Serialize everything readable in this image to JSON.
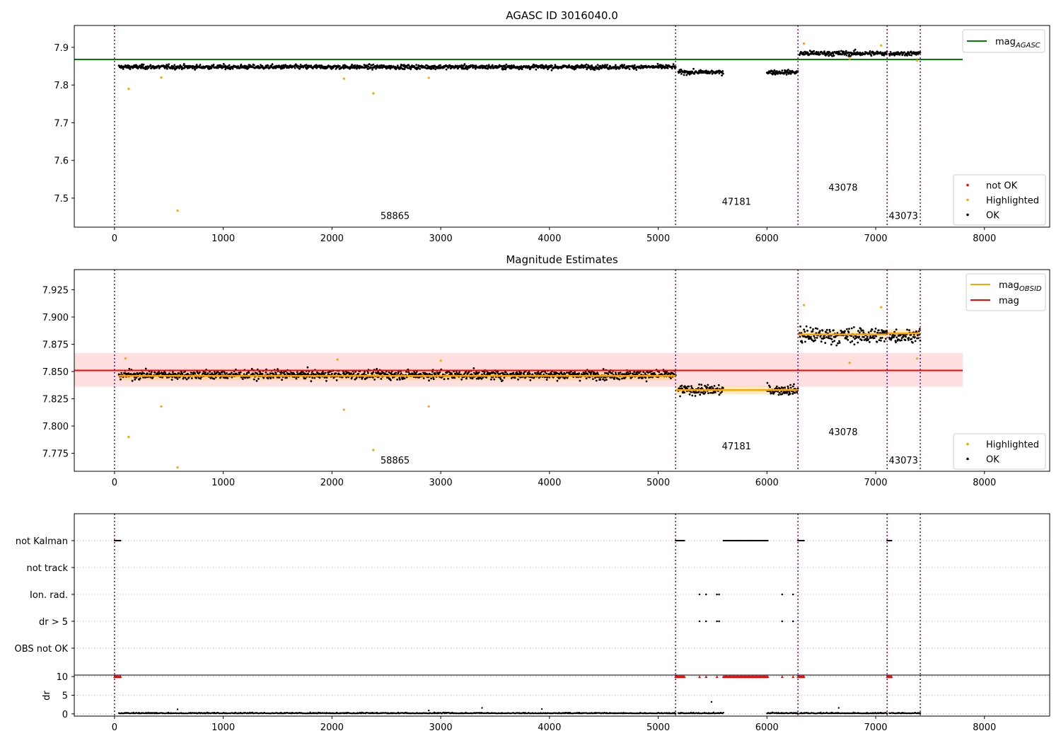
{
  "chart_data": [
    {
      "type": "scatter",
      "title": "AGASC ID 3016040.0",
      "xlim": [
        -370,
        8600
      ],
      "ylim": [
        7.423,
        7.958
      ],
      "xticks": [
        0,
        1000,
        2000,
        3000,
        4000,
        5000,
        6000,
        7000,
        8000
      ],
      "yticks": [
        7.5,
        7.6,
        7.7,
        7.8,
        7.9
      ],
      "obsid_boundaries": [
        0,
        5160,
        6285,
        7105,
        7410
      ],
      "obsid_labels": [
        {
          "text": "58865",
          "x": 2580,
          "y": 7.445
        },
        {
          "text": "47181",
          "x": 5720,
          "y": 7.482
        },
        {
          "text": "43078",
          "x": 6700,
          "y": 7.52
        },
        {
          "text": "43073",
          "x": 7255,
          "y": 7.445
        }
      ],
      "segments": [
        {
          "x0": 40,
          "x1": 5160,
          "mean": 7.848,
          "spread": 0.006
        },
        {
          "x0": 5185,
          "x1": 5600,
          "mean": 7.834,
          "spread": 0.006
        },
        {
          "x0": 6000,
          "x1": 6285,
          "mean": 7.834,
          "spread": 0.006
        },
        {
          "x0": 6300,
          "x1": 7105,
          "mean": 7.884,
          "spread": 0.007
        },
        {
          "x0": 7125,
          "x1": 7410,
          "mean": 7.884,
          "spread": 0.006
        }
      ],
      "highlighted_points": [
        [
          130,
          7.79
        ],
        [
          430,
          7.82
        ],
        [
          580,
          7.467
        ],
        [
          2110,
          7.817
        ],
        [
          2380,
          7.778
        ],
        [
          2890,
          7.819
        ],
        [
          6340,
          7.91
        ],
        [
          6760,
          7.87
        ],
        [
          7050,
          7.905
        ],
        [
          7380,
          7.865
        ]
      ],
      "reference_lines": [
        {
          "name": "mag_AGASC",
          "y": 7.868,
          "x0": -370,
          "x1": 7800,
          "color": "#008000"
        }
      ],
      "legends": [
        {
          "position": "top-right",
          "items": [
            {
              "label": "mag",
              "subscript": "AGASC",
              "kind": "line",
              "color": "#008000"
            }
          ]
        },
        {
          "position": "lower-right",
          "items": [
            {
              "label": "not OK",
              "kind": "dot",
              "color": "#ff0000"
            },
            {
              "label": "Highlighted",
              "kind": "dot",
              "color": "#ffa500"
            },
            {
              "label": "OK",
              "kind": "dot",
              "color": "#000000"
            }
          ]
        }
      ]
    },
    {
      "type": "scatter",
      "title": "Magnitude Estimates",
      "xlim": [
        -370,
        8600
      ],
      "ylim": [
        7.7585,
        7.9435
      ],
      "xticks": [
        0,
        1000,
        2000,
        3000,
        4000,
        5000,
        6000,
        7000,
        8000
      ],
      "yticks": [
        7.775,
        7.8,
        7.825,
        7.85,
        7.875,
        7.9,
        7.925
      ],
      "obsid_boundaries": [
        0,
        5160,
        6285,
        7105,
        7410
      ],
      "obsid_labels": [
        {
          "text": "58865",
          "x": 2580,
          "y": 7.7655
        },
        {
          "text": "47181",
          "x": 5720,
          "y": 7.7785
        },
        {
          "text": "43078",
          "x": 6700,
          "y": 7.7915
        },
        {
          "text": "43073",
          "x": 7255,
          "y": 7.7655
        }
      ],
      "segments": [
        {
          "x0": 40,
          "x1": 5160,
          "mean": 7.847,
          "spread": 0.0045
        },
        {
          "x0": 5185,
          "x1": 5600,
          "mean": 7.833,
          "spread": 0.005
        },
        {
          "x0": 6000,
          "x1": 6285,
          "mean": 7.833,
          "spread": 0.005
        },
        {
          "x0": 6300,
          "x1": 7105,
          "mean": 7.883,
          "spread": 0.008
        },
        {
          "x0": 7125,
          "x1": 7410,
          "mean": 7.883,
          "spread": 0.006
        }
      ],
      "highlighted_points": [
        [
          130,
          7.79
        ],
        [
          430,
          7.818
        ],
        [
          580,
          7.762
        ],
        [
          2110,
          7.815
        ],
        [
          2380,
          7.778
        ],
        [
          2890,
          7.818
        ],
        [
          6340,
          7.911
        ],
        [
          6760,
          7.858
        ],
        [
          7050,
          7.909
        ],
        [
          7380,
          7.862
        ],
        [
          100,
          7.862
        ],
        [
          2050,
          7.861
        ],
        [
          3000,
          7.86
        ]
      ],
      "mag_obsid": [
        {
          "x0": 40,
          "x1": 5160,
          "y": 7.846
        },
        {
          "x0": 5160,
          "x1": 6285,
          "y": 7.833
        },
        {
          "x0": 6285,
          "x1": 7105,
          "y": 7.884
        },
        {
          "x0": 7105,
          "x1": 7410,
          "y": 7.885
        }
      ],
      "mag_line": {
        "y": 7.851,
        "x0": -370,
        "x1": 7800,
        "band": [
          7.836,
          7.867
        ]
      },
      "legends": [
        {
          "position": "top-right",
          "items": [
            {
              "label": "mag",
              "subscript": "OBSID",
              "kind": "line",
              "color": "#ffa500"
            },
            {
              "label": "mag",
              "subscript": "",
              "kind": "line",
              "color": "#ff0000"
            }
          ]
        },
        {
          "position": "lower-right",
          "items": [
            {
              "label": "Highlighted",
              "kind": "dot",
              "color": "#ffa500"
            },
            {
              "label": "OK",
              "kind": "dot",
              "color": "#000000"
            }
          ]
        }
      ]
    },
    {
      "type": "scatter",
      "title": "",
      "xlim": [
        -370,
        8600
      ],
      "xticks": [
        0,
        1000,
        2000,
        3000,
        4000,
        5000,
        6000,
        7000,
        8000
      ],
      "categories": [
        "not Kalman",
        "not track",
        "Ion. rad.",
        "dr > 5",
        "OBS not OK"
      ],
      "obsid_boundaries": [
        0,
        5160,
        6285,
        7105,
        7410
      ],
      "flag_ranges": [
        {
          "category": "not Kalman",
          "ranges": [
            [
              0,
              60
            ],
            [
              5160,
              5240
            ],
            [
              5600,
              6010
            ],
            [
              6285,
              6345
            ],
            [
              7105,
              7150
            ]
          ]
        },
        {
          "category": "Ion. rad.",
          "points": [
            5380,
            5440,
            5540,
            5560,
            6140,
            6240
          ]
        },
        {
          "category": "dr > 5",
          "points": [
            5380,
            5440,
            5540,
            5560,
            6140,
            6240
          ]
        }
      ]
    },
    {
      "type": "scatter",
      "title": "",
      "ylabel": "dr",
      "xlim": [
        -370,
        8600
      ],
      "ylim": [
        -0.6,
        10.4
      ],
      "xticks": [
        0,
        1000,
        2000,
        3000,
        4000,
        5000,
        6000,
        7000,
        8000
      ],
      "yticks": [
        0,
        5,
        10
      ],
      "obsid_boundaries": [
        0,
        5160,
        6285,
        7105,
        7410
      ],
      "clipped_ranges": [
        [
          0,
          60
        ],
        [
          5160,
          5240
        ],
        [
          5600,
          6010
        ],
        [
          6285,
          6345
        ],
        [
          7105,
          7150
        ]
      ],
      "clipped_points": [
        5380,
        5440,
        5540,
        6140,
        6240
      ],
      "outliers": [
        [
          580,
          1.2
        ],
        [
          2890,
          0.9
        ],
        [
          3380,
          1.6
        ],
        [
          3930,
          1.3
        ],
        [
          5490,
          3.2
        ],
        [
          6660,
          1.6
        ]
      ]
    }
  ]
}
